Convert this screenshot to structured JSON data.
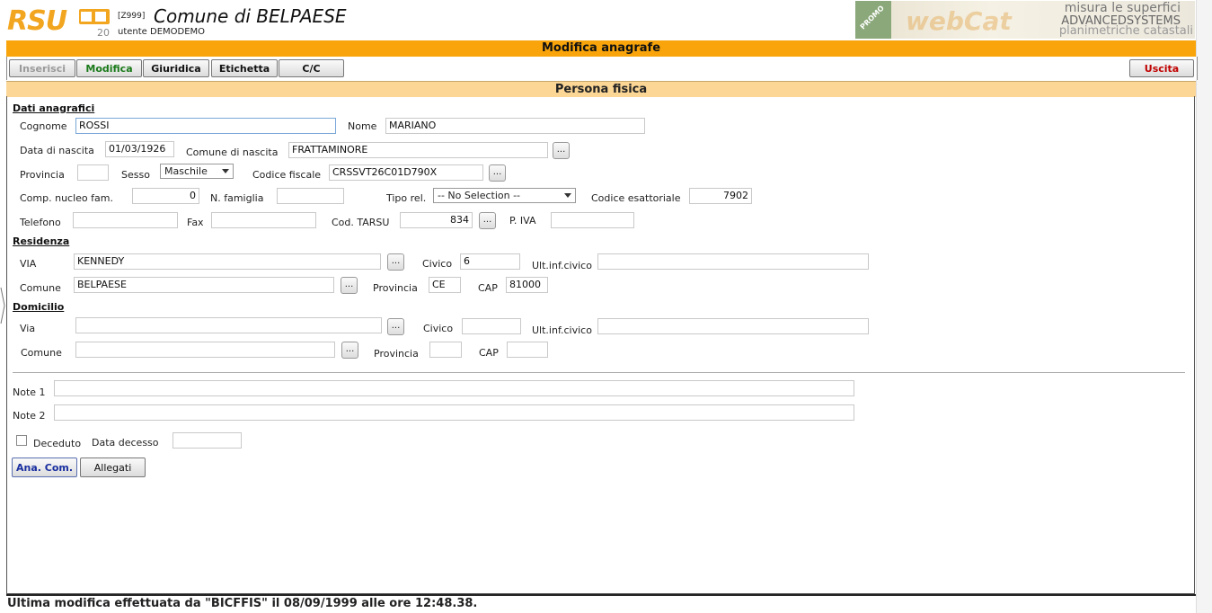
{
  "header": {
    "logo_text": "RSU",
    "logo_number": "20",
    "code": "[Z999]",
    "comune_title": "Comune di BELPAESE",
    "utente": "utente DEMODEMO"
  },
  "banner": {
    "promo": "PROMO",
    "brand": "webCat",
    "line1": "misura le superfici",
    "line2": "ADVANCEDSYSTEMS",
    "line3": "planimetriche catastali"
  },
  "page_title": "Modifica anagrafe",
  "toolbar": {
    "inserisci": "Inserisci",
    "modifica": "Modifica",
    "giuridica": "Giuridica",
    "etichetta": "Etichetta",
    "cc": "C/C",
    "uscita": "Uscita"
  },
  "section_title": "Persona fisica",
  "dati": {
    "header": "Dati anagrafici",
    "cognome_label": "Cognome",
    "cognome": "ROSSI",
    "nome_label": "Nome",
    "nome": "MARIANO",
    "data_nascita_label": "Data di nascita",
    "data_nascita": "01/03/1926",
    "comune_nascita_label": "Comune di nascita",
    "comune_nascita": "FRATTAMINORE",
    "provincia_label": "Provincia",
    "provincia": "",
    "sesso_label": "Sesso",
    "sesso": "Maschile",
    "codice_fiscale_label": "Codice fiscale",
    "codice_fiscale": "CRSSVT26C01D790X",
    "comp_nucleo_label": "Comp. nucleo fam.",
    "comp_nucleo": "0",
    "n_famiglia_label": "N. famiglia",
    "n_famiglia": "",
    "tipo_rel_label": "Tipo rel.",
    "tipo_rel": "-- No Selection --",
    "codice_esattoriale_label": "Codice esattoriale",
    "codice_esattoriale": "7902",
    "telefono_label": "Telefono",
    "telefono": "",
    "fax_label": "Fax",
    "fax": "",
    "cod_tarsu_label": "Cod. TARSU",
    "cod_tarsu": "834",
    "piva_label": "P. IVA",
    "piva": ""
  },
  "residenza": {
    "header": "Residenza",
    "via_label": "VIA",
    "via": "KENNEDY",
    "civico_label": "Civico",
    "civico": "6",
    "ult_label": "Ult.inf.civico",
    "ult": "",
    "comune_label": "Comune",
    "comune": "BELPAESE",
    "provincia_label": "Provincia",
    "provincia": "CE",
    "cap_label": "CAP",
    "cap": "81000"
  },
  "domicilio": {
    "header": "Domicilio",
    "via_label": "Via",
    "via": "",
    "civico_label": "Civico",
    "civico": "",
    "ult_label": "Ult.inf.civico",
    "ult": "",
    "comune_label": "Comune",
    "comune": "",
    "provincia_label": "Provincia",
    "provincia": "",
    "cap_label": "CAP",
    "cap": ""
  },
  "note": {
    "note1_label": "Note 1",
    "note1": "",
    "note2_label": "Note 2",
    "note2": ""
  },
  "decesso": {
    "deceduto_label": "Deceduto",
    "data_label": "Data decesso",
    "data": ""
  },
  "buttons": {
    "ana_com": "Ana. Com.",
    "allegati": "Allegati",
    "dots": "..."
  },
  "status_text": "Ultima modifica effettuata da \"BICFFIS\" il 08/09/1999 alle ore 12:48.38.",
  "colors": {
    "orange": "#f8a40a",
    "section": "#fbd695",
    "modifica_green": "#1a7a1a",
    "uscita_red": "#c00000",
    "ana_blue": "#1a2fa0"
  }
}
